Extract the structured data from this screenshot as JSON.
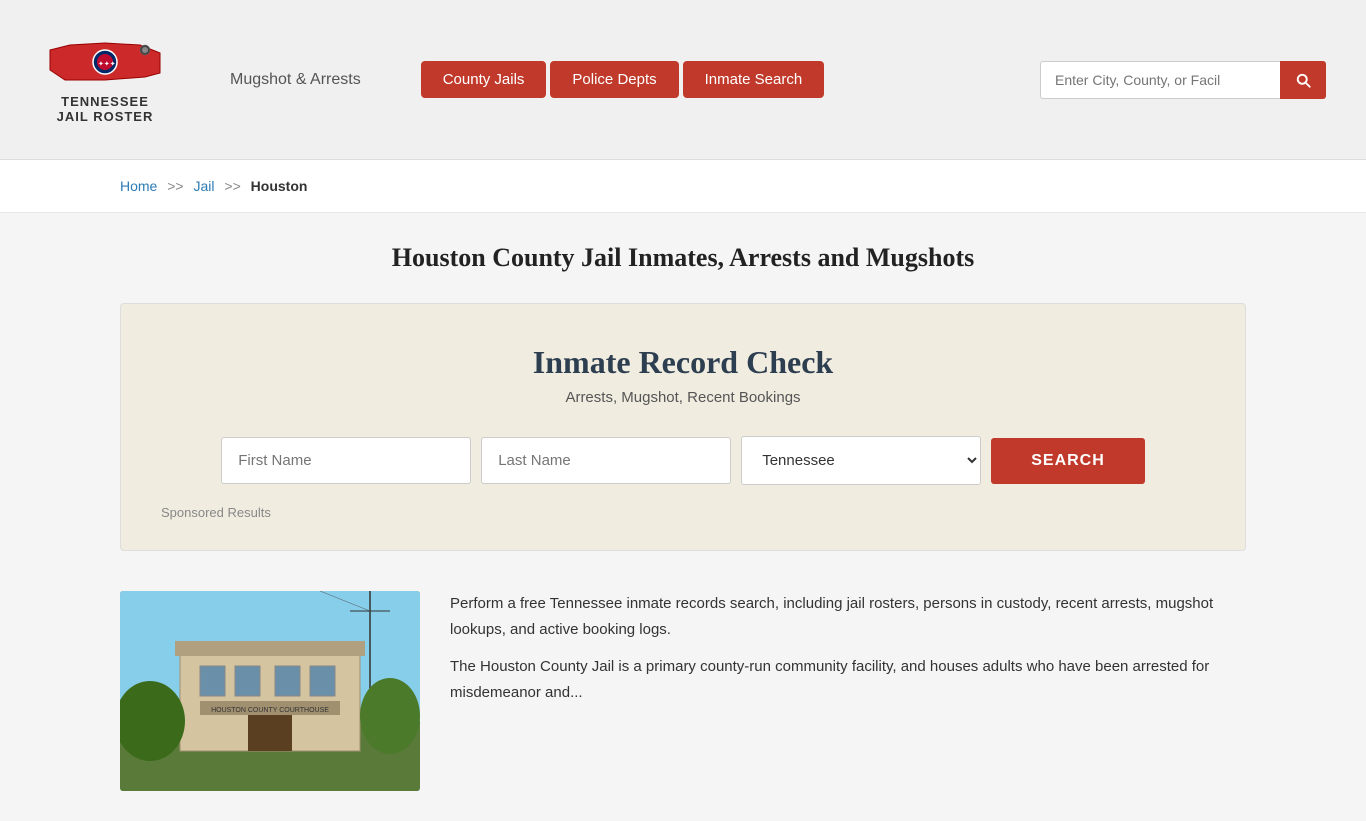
{
  "header": {
    "logo_line1": "TENNESSEE",
    "logo_line2": "JAIL ROSTER",
    "mugshot_link": "Mugshot & Arrests",
    "nav_buttons": [
      {
        "label": "County Jails",
        "id": "county-jails"
      },
      {
        "label": "Police Depts",
        "id": "police-depts"
      },
      {
        "label": "Inmate Search",
        "id": "inmate-search"
      }
    ],
    "search_placeholder": "Enter City, County, or Facil"
  },
  "breadcrumb": {
    "home": "Home",
    "sep1": ">>",
    "jail": "Jail",
    "sep2": ">>",
    "current": "Houston"
  },
  "page": {
    "title": "Houston County Jail Inmates, Arrests and Mugshots"
  },
  "record_check": {
    "title": "Inmate Record Check",
    "subtitle": "Arrests, Mugshot, Recent Bookings",
    "first_name_placeholder": "First Name",
    "last_name_placeholder": "Last Name",
    "state_default": "Tennessee",
    "search_button": "SEARCH",
    "sponsored_label": "Sponsored Results"
  },
  "content": {
    "paragraph1": "Perform a free Tennessee inmate records search, including jail rosters, persons in custody, recent arrests, mugshot lookups, and active booking logs.",
    "paragraph2": "The Houston County Jail is a primary county-run community facility, and houses adults who have been arrested for misdemeanor and..."
  }
}
